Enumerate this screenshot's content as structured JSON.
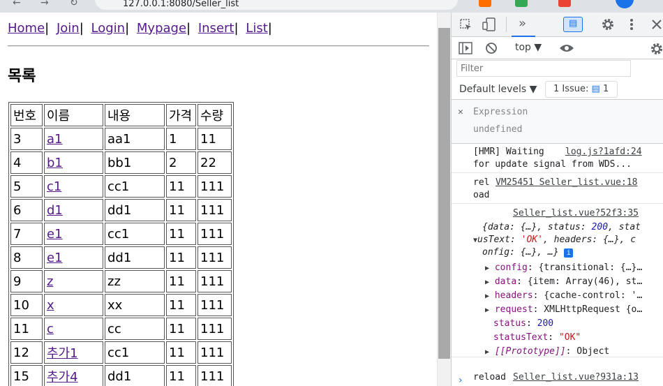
{
  "browser": {
    "url": "127.0.0.1:8080/Seller_list"
  },
  "page": {
    "nav": [
      {
        "label": "Home"
      },
      {
        "label": "Join"
      },
      {
        "label": "Login"
      },
      {
        "label": "Mypage"
      },
      {
        "label": "Insert"
      },
      {
        "label": "List"
      }
    ],
    "nav_separator": "|",
    "title": "목록",
    "table": {
      "headers": [
        "번호",
        "이름",
        "내용",
        "가격",
        "수량"
      ],
      "rows": [
        [
          "3",
          "a1",
          "aa1",
          "1",
          "11"
        ],
        [
          "4",
          "b1",
          "bb1",
          "2",
          "22"
        ],
        [
          "5",
          "c1",
          "cc1",
          "11",
          "111"
        ],
        [
          "6",
          "d1",
          "dd1",
          "11",
          "111"
        ],
        [
          "7",
          "e1",
          "cc1",
          "11",
          "111"
        ],
        [
          "8",
          "e1",
          "dd1",
          "11",
          "111"
        ],
        [
          "9",
          "z",
          "zz",
          "11",
          "111"
        ],
        [
          "10",
          "x",
          "xx",
          "11",
          "111"
        ],
        [
          "11",
          "c",
          "cc",
          "11",
          "111"
        ],
        [
          "12",
          "추가1",
          "cc1",
          "11",
          "111"
        ],
        [
          "15",
          "추가4",
          "dd1",
          "11",
          "111"
        ]
      ]
    }
  },
  "devtools": {
    "more_tabs": "»",
    "context": "top ▼",
    "filter_placeholder": "Filter",
    "levels": "Default levels ▼",
    "issues": "1 Issue:",
    "issues_count": "1",
    "expression": {
      "label": "Expression",
      "value": "undefined"
    },
    "messages": {
      "hmr_line1": "[HMR] Waiting",
      "hmr_source": "log.js?1afd:24",
      "hmr_line2": "for update signal from WDS...",
      "rel_text": "rel",
      "rel_source": "VM25451 Seller_list.vue:18",
      "oad_text": "oad",
      "obj_source": "Seller_list.vue?52f3:35",
      "obj_line1_a": "{data: {…}, status: ",
      "obj_line1_status": "200",
      "obj_line1_b": ", stat",
      "obj_line2_a": "usText: ",
      "obj_line2_str": "'OK'",
      "obj_line2_b": ", headers: {…}, c",
      "obj_line3": "onfig: {…}, …}",
      "info_badge": "i",
      "props": [
        {
          "key": "config",
          "value": ": {transitional: {…}…"
        },
        {
          "key": "data",
          "value": ": {item: Array(46), st…"
        },
        {
          "key": "headers",
          "value": ": {cache-control: '…"
        },
        {
          "key": "request",
          "value": ": XMLHttpRequest {o…"
        }
      ],
      "status_key": "status",
      "status_val": "200",
      "statustext_key": "statusText",
      "statustext_val": "\"OK\"",
      "proto_key": "[[Prototype]]",
      "proto_val": ": Object",
      "reload_text": "reload",
      "reload_source": "Seller_list.vue?931a:13"
    },
    "prompt": "›"
  },
  "colors": {
    "link_visited": "#551a8b",
    "accent": "#1a73e8"
  }
}
